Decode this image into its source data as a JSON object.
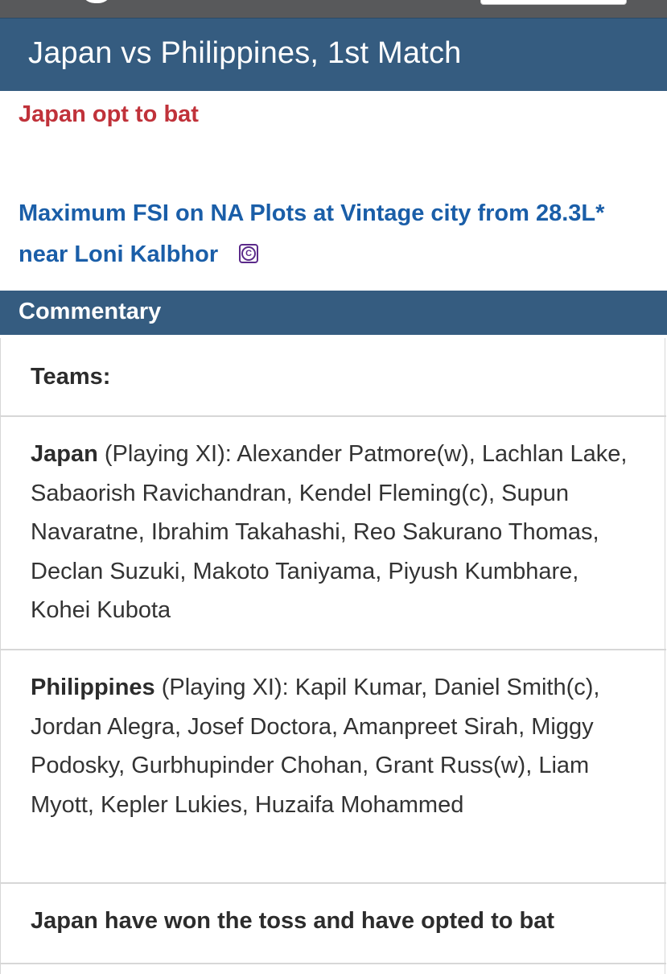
{
  "header": {
    "match_title": "Japan vs Philippines, 1st Match"
  },
  "status": {
    "toss_status": "Japan opt to bat"
  },
  "ad": {
    "text": "Maximum FSI on NA Plots at Vintage city from 28.3L* near Loni Kalbhor",
    "icon": "adchoices-icon",
    "icon_color": "#5b2a8a"
  },
  "commentary": {
    "title": "Commentary",
    "items": [
      {
        "bold": "Teams:",
        "text": ""
      },
      {
        "bold": "Japan",
        "text": " (Playing XI): Alexander Patmore(w), Lachlan Lake, Sabaorish Ravichandran, Kendel Fleming(c), Supun Navaratne, Ibrahim Takahashi, Reo Sakurano Thomas, Declan Suzuki, Makoto Taniyama, Piyush Kumbhare, Kohei Kubota"
      },
      {
        "bold": "Philippines",
        "text": " (Playing XI): Kapil Kumar, Daniel Smith(c), Jordan Alegra, Josef Doctora, Amanpreet Sirah, Miggy Podosky, Gurbhupinder Chohan, Grant Russ(w), Liam Myott, Kepler Lukies, Huzaifa Mohammed"
      },
      {
        "bold": "Japan have won the toss and have opted to bat",
        "text": ""
      }
    ]
  },
  "colors": {
    "header_bg": "#355c80",
    "status_red": "#c0323a",
    "link_blue": "#1a5ea8",
    "topbar": "#58595b"
  }
}
